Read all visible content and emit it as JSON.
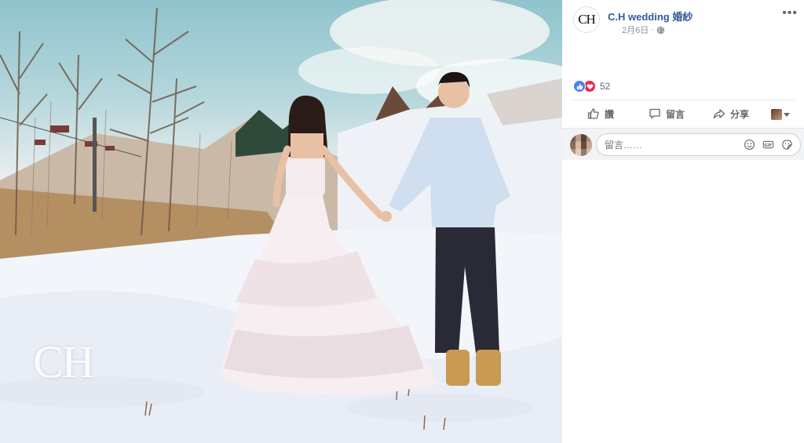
{
  "post": {
    "page_name": "C.H wedding 婚紗",
    "date": "2月6日",
    "separator": "·",
    "avatar_text": "CH"
  },
  "photo": {
    "watermark": "CH"
  },
  "reactions": {
    "count": "52",
    "types": [
      "like",
      "love"
    ]
  },
  "actions": {
    "like_label": "讚",
    "comment_label": "留言",
    "share_label": "分享"
  },
  "comment_box": {
    "placeholder": "留言……"
  },
  "icons": {
    "more": "more-options-icon",
    "privacy": "globe-icon",
    "emoji": "emoji-icon",
    "gif": "gif-icon",
    "sticker": "sticker-icon"
  },
  "colors": {
    "link_blue": "#365899",
    "like_blue": "#4a80f5",
    "love_red": "#f0284a",
    "muted": "#606770"
  }
}
